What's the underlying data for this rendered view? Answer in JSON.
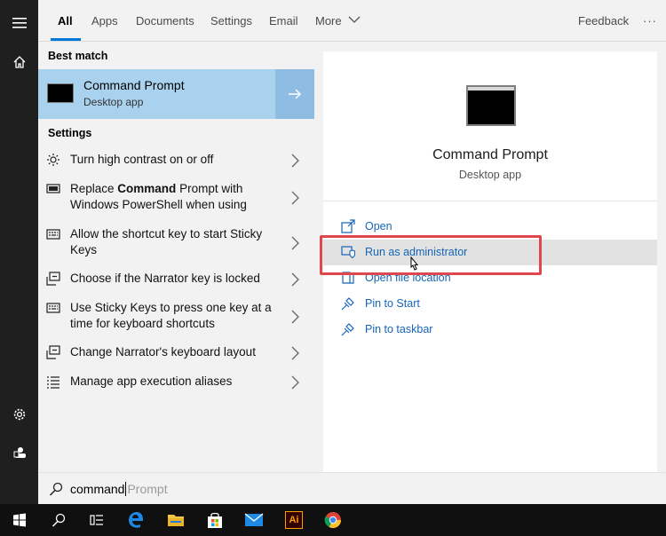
{
  "tabs": {
    "items": [
      "All",
      "Apps",
      "Documents",
      "Settings",
      "Email",
      "More"
    ],
    "feedback": "Feedback",
    "more_options": "···"
  },
  "left": {
    "best_match_title": "Best match",
    "best_match": {
      "name": "Command Prompt",
      "type": "Desktop app"
    },
    "settings_title": "Settings",
    "settings_items": [
      {
        "icon": "brightness-icon",
        "text": "Turn high contrast on or off"
      },
      {
        "icon": "monitor-icon",
        "parts": [
          "Replace ",
          "Command",
          " Prompt with Windows PowerShell when using"
        ]
      },
      {
        "icon": "keyboard-icon",
        "text": "Allow the shortcut key to start Sticky Keys"
      },
      {
        "icon": "narrator-icon",
        "text": "Choose if the Narrator key is locked"
      },
      {
        "icon": "keyboard-icon",
        "text": "Use Sticky Keys to press one key at a time for keyboard shortcuts"
      },
      {
        "icon": "narrator-icon",
        "text": "Change Narrator's keyboard layout"
      },
      {
        "icon": "list-icon",
        "text": "Manage app execution aliases"
      }
    ]
  },
  "right": {
    "title": "Command Prompt",
    "subtitle": "Desktop app",
    "actions": [
      {
        "icon": "open-icon",
        "label": "Open"
      },
      {
        "icon": "shield-icon",
        "label": "Run as administrator"
      },
      {
        "icon": "folder-icon",
        "label": "Open file location"
      },
      {
        "icon": "pin-icon",
        "label": "Pin to Start"
      },
      {
        "icon": "pin-icon",
        "label": "Pin to taskbar"
      }
    ]
  },
  "search": {
    "query": "command",
    "suggestion": "Prompt"
  },
  "taskbar": {
    "items": [
      "windows-start-icon",
      "search-icon",
      "task-view-icon",
      "edge-icon",
      "file-explorer-icon",
      "store-icon",
      "mail-icon",
      "illustrator-icon",
      "chrome-icon"
    ],
    "illustrator_label": "Ai"
  },
  "colors": {
    "accent": "#0078d7",
    "best_match_bg": "#a9d2ef",
    "link": "#1565b7",
    "highlight_box": "#e0464d",
    "rail": "#1f1f1f",
    "taskbar": "#101010"
  }
}
